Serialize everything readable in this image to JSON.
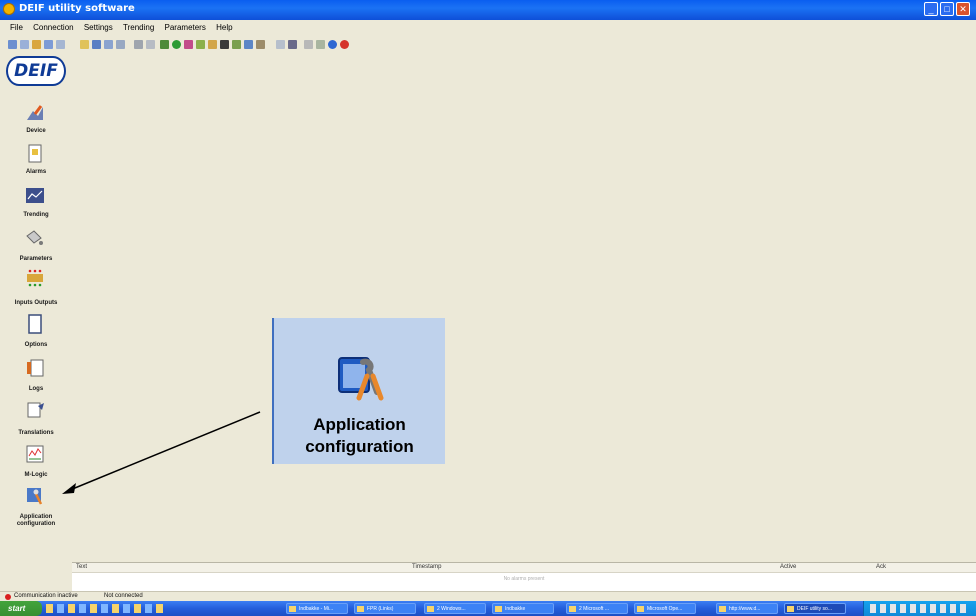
{
  "window": {
    "title": "DEIF utility software"
  },
  "menu": [
    "File",
    "Connection",
    "Settings",
    "Trending",
    "Parameters",
    "Help"
  ],
  "sidebar": {
    "logo": "DEIF",
    "items": [
      {
        "label": "Device",
        "icon": "device-icon"
      },
      {
        "label": "Alarms",
        "icon": "alarms-icon"
      },
      {
        "label": "Trending",
        "icon": "trending-icon"
      },
      {
        "label": "Parameters",
        "icon": "parameters-icon"
      },
      {
        "label": "Inputs Outputs",
        "icon": "inputs-outputs-icon"
      },
      {
        "label": "Options",
        "icon": "options-icon"
      },
      {
        "label": "Logs",
        "icon": "logs-icon"
      },
      {
        "label": "Translations",
        "icon": "translations-icon"
      },
      {
        "label": "M-Logic",
        "icon": "m-logic-icon"
      },
      {
        "label": "Application configuration",
        "icon": "application-configuration-icon"
      }
    ]
  },
  "callout": {
    "label_line1": "Application",
    "label_line2": "configuration",
    "icon": "application-configuration-icon"
  },
  "log": {
    "columns": [
      "Text",
      "Timestamp",
      "Active",
      "Ack"
    ],
    "empty_message": "No alarms present"
  },
  "status": {
    "communication": "Communication inactive",
    "connection": "Not connected"
  },
  "taskbar": {
    "start": "start",
    "buttons": [
      "Indbakke - Mi...",
      "FPR (Links)",
      "2 Windows...",
      "Indbakke",
      "2 Microsoft ...",
      "Microsoft Ope...",
      "http://www.d...",
      "DEIF utility so..."
    ]
  },
  "colors": {
    "titlebar": "#0a5ef0",
    "callout_bg": "#bfd2ec",
    "window_bg": "#ece9d8",
    "deif_blue": "#0f3b96"
  }
}
